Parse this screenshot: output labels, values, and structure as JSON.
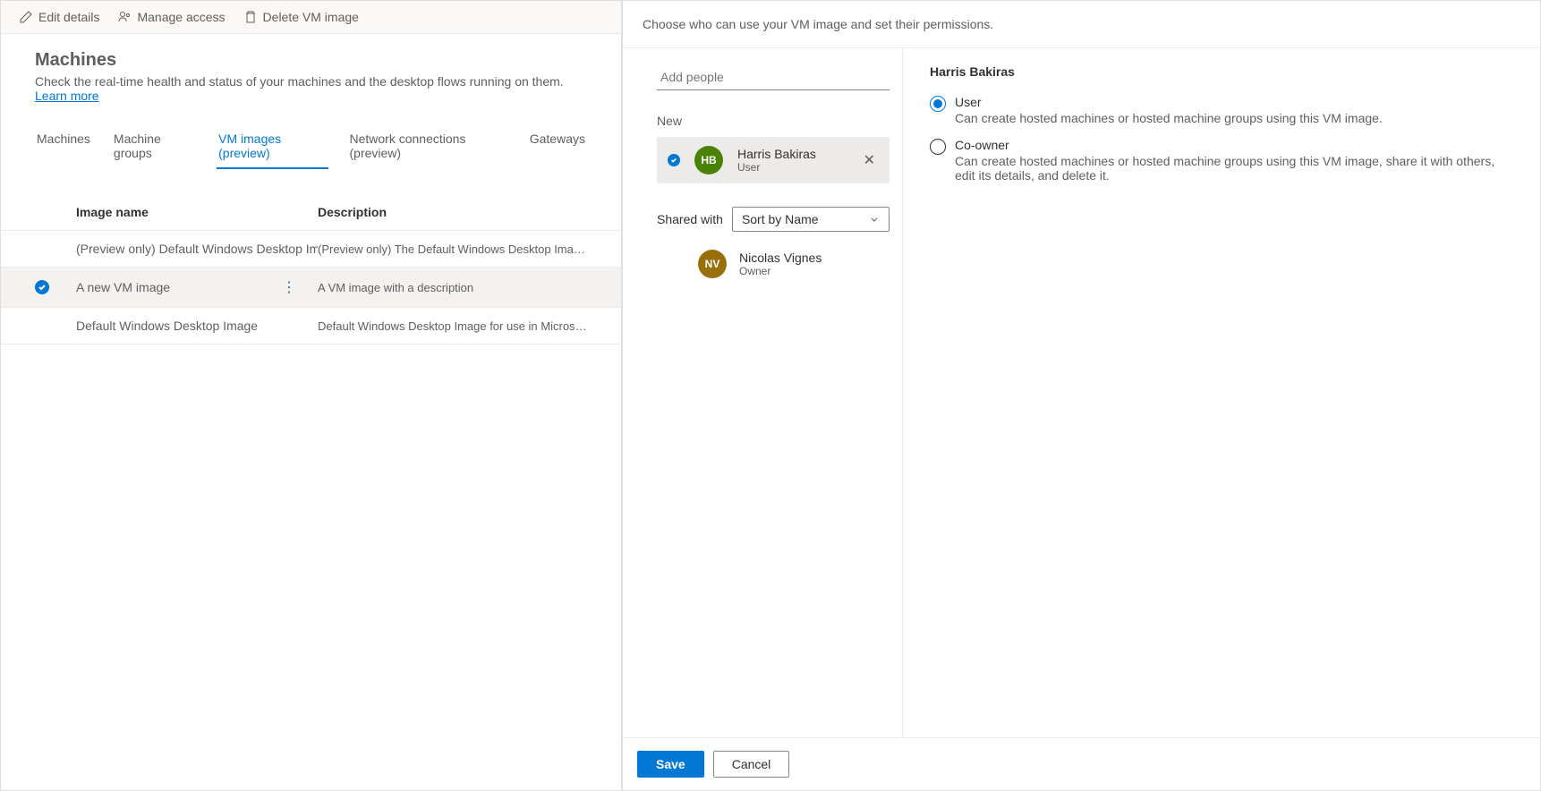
{
  "toolbar": {
    "edit_label": "Edit details",
    "manage_label": "Manage access",
    "delete_label": "Delete VM image"
  },
  "page": {
    "title": "Machines",
    "subtitle_text": "Check the real-time health and status of your machines and the desktop flows running on them. ",
    "learn_more": "Learn more"
  },
  "tabs": {
    "machines": "Machines",
    "groups": "Machine groups",
    "vmimages": "VM images (preview)",
    "network": "Network connections (preview)",
    "gateways": "Gateways"
  },
  "table": {
    "col_name": "Image name",
    "col_desc": "Description",
    "rows": [
      {
        "name": "(Preview only) Default Windows Desktop Ima...",
        "desc": "(Preview only) The Default Windows Desktop Image for use i...",
        "selected": false
      },
      {
        "name": "A new VM image",
        "desc": "A VM image with a description",
        "selected": true
      },
      {
        "name": "Default Windows Desktop Image",
        "desc": "Default Windows Desktop Image for use in Microsoft Deskto...",
        "selected": false
      }
    ]
  },
  "panel": {
    "header": "Choose who can use your VM image and set their permissions.",
    "add_people_placeholder": "Add people",
    "new_label": "New",
    "new_person": {
      "initials": "HB",
      "name": "Harris Bakiras",
      "role": "User"
    },
    "shared_with_label": "Shared with",
    "sort_label": "Sort by Name",
    "shared_person": {
      "initials": "NV",
      "name": "Nicolas Vignes",
      "role": "Owner"
    },
    "right": {
      "title": "Harris Bakiras",
      "options": [
        {
          "label": "User",
          "desc": "Can create hosted machines or hosted machine groups using this VM image.",
          "checked": true
        },
        {
          "label": "Co-owner",
          "desc": "Can create hosted machines or hosted machine groups using this VM image, share it with others, edit its details, and delete it.",
          "checked": false
        }
      ]
    },
    "save_label": "Save",
    "cancel_label": "Cancel"
  }
}
